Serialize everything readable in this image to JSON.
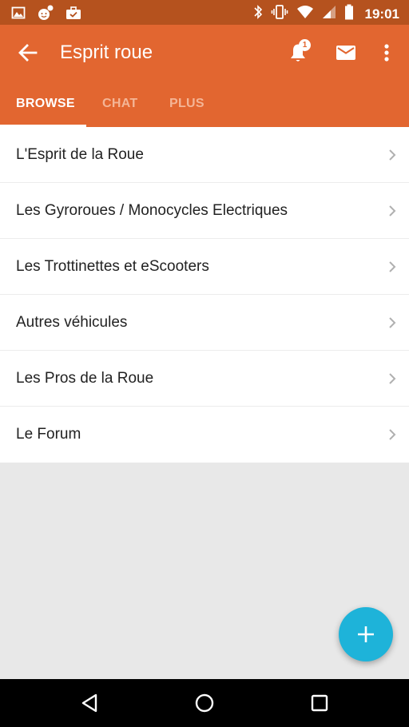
{
  "status_bar": {
    "time": "19:01",
    "left_icons": [
      "image-icon",
      "smiley-notification-icon",
      "briefcase-notification-icon"
    ],
    "right_icons": [
      "bluetooth-icon",
      "vibrate-icon",
      "wifi-icon",
      "signal-icon",
      "battery-icon"
    ]
  },
  "toolbar": {
    "title": "Esprit roue",
    "notification_count": "1"
  },
  "tabs": [
    {
      "label": "BROWSE",
      "active": true
    },
    {
      "label": "CHAT",
      "active": false
    },
    {
      "label": "PLUS",
      "active": false
    }
  ],
  "list": {
    "items": [
      {
        "label": "L'Esprit de la Roue"
      },
      {
        "label": "Les Gyroroues / Monocycles Electriques"
      },
      {
        "label": "Les Trottinettes et eScooters"
      },
      {
        "label": "Autres véhicules"
      },
      {
        "label": "Les Pros de la Roue"
      },
      {
        "label": "Le Forum"
      }
    ]
  },
  "colors": {
    "app_bar": "#e26630",
    "status_bar": "#b5521e",
    "fab": "#1eb3d9",
    "background": "#e8e8e8"
  }
}
